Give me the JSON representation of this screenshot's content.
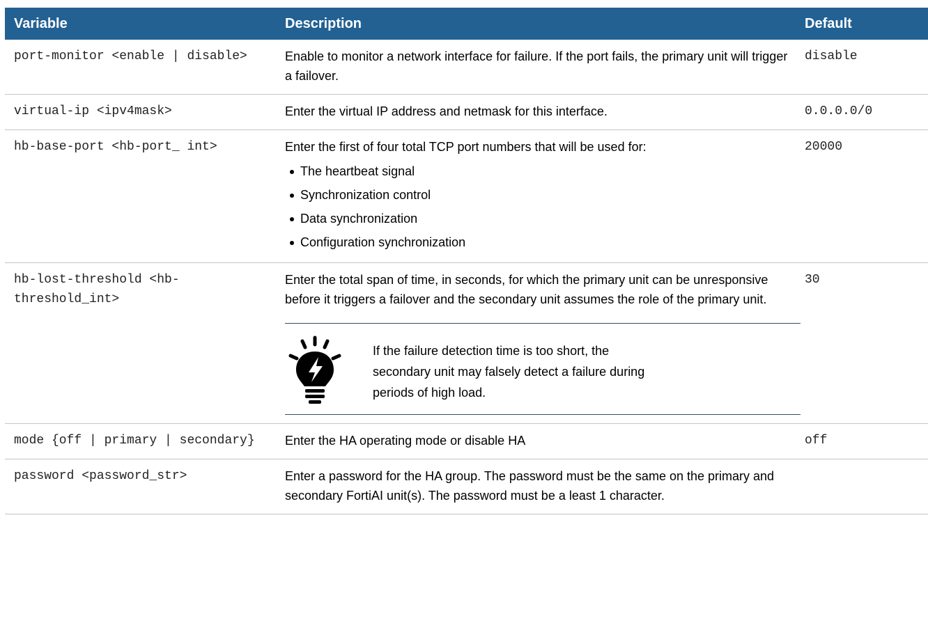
{
  "header": {
    "variable": "Variable",
    "description": "Description",
    "default": "Default"
  },
  "rows": [
    {
      "variable": "port-monitor <enable | disable>",
      "description": "Enable to monitor a network interface for failure. If the port fails, the primary unit will trigger a failover.",
      "default": "disable"
    },
    {
      "variable": "virtual-ip <ipv4mask>",
      "description": "Enter the virtual IP address and netmask for this interface.",
      "default": "0.0.0.0/0"
    },
    {
      "variable": "hb-base-port <hb-port_ int>",
      "description": "Enter the first of four total TCP port numbers that will be used for:",
      "bullets": [
        "The heartbeat signal",
        "Synchronization control",
        "Data synchronization",
        "Configuration synchronization"
      ],
      "default": "20000"
    },
    {
      "variable": "hb-lost-threshold <hb-threshold_int>",
      "description": "Enter the total span of time, in seconds, for which the primary unit  can be unresponsive before it triggers a failover and the secondary unit assumes the role of the primary unit.",
      "tip": "If the failure detection time is too short, the secondary unit may falsely detect a failure during periods of high load.",
      "default": "30"
    },
    {
      "variable": "mode {off | primary | secondary}",
      "description": "Enter the HA operating mode or disable HA",
      "default": "off"
    },
    {
      "variable": "password <password_str>",
      "description": "Enter a password for the HA group. The password must be the same on the primary and secondary FortiAI unit(s). The password must be a least 1 character.",
      "default": ""
    }
  ],
  "icons": {
    "tip": "lightbulb-tip-icon"
  },
  "colors": {
    "header_bg": "#236193",
    "header_text": "#ffffff"
  }
}
